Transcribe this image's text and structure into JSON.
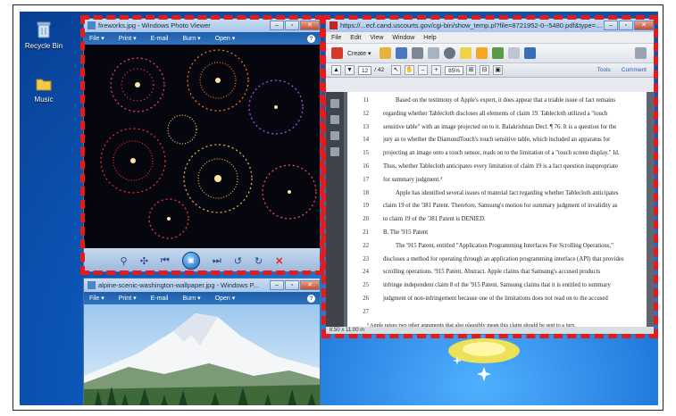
{
  "desktop": {
    "icons": [
      {
        "label": "Recycle Bin",
        "icon": "recycle-bin-icon"
      },
      {
        "label": "Music",
        "icon": "folder-icon"
      }
    ]
  },
  "photo_viewer_1": {
    "title": "fireworks.jpg - Windows Photo Viewer",
    "menu": [
      "File ▾",
      "Print ▾",
      "E-mail",
      "Burn ▾",
      "Open ▾"
    ],
    "controls": [
      "zoom-icon",
      "fit-icon",
      "previous-icon",
      "slideshow-icon",
      "next-icon",
      "rotate-left-icon",
      "rotate-right-icon",
      "delete-icon"
    ]
  },
  "photo_viewer_2": {
    "title": "alpine-scenic-washington-wallpaper.jpg - Windows P...",
    "menu": [
      "File ▾",
      "Print ▾",
      "E-mail",
      "Burn ▾",
      "Open ▾"
    ]
  },
  "pdf_window": {
    "title": "https://...ecf.cand.uscourts.gov/cgi-bin/show_temp.pl?file=8721952-0--5480.pdf&type=applica...",
    "menu": [
      "File",
      "Edit",
      "View",
      "Window",
      "Help"
    ],
    "create_label": "Create ▾",
    "page_current": "12",
    "page_total": "/ 42",
    "zoom": "85%",
    "tools_label": "Tools",
    "comment_label": "Comment",
    "page_size": "8.50 x 11.00 in",
    "lines": [
      {
        "n": "11",
        "t": "Based on the testimony of Apple's expert, it does appear that a triable issue of fact remains"
      },
      {
        "n": "12",
        "t": "regarding whether Tablecloth discloses all elements of claim 19. Tablecloth utilized a \"touch"
      },
      {
        "n": "13",
        "t": "sensitive table\" with an image projected on to it. Balakrishnan Decl. ¶ 76. It is a question for the"
      },
      {
        "n": "14",
        "t": "jury as to whether the DiamondTouch's touch sensitive table, which included an apparatus for"
      },
      {
        "n": "15",
        "t": "projecting an image onto a touch sensor, reads on to the limitation of a \"touch screen display.\" Id."
      },
      {
        "n": "16",
        "t": "Thus, whether Tablecloth anticipates every limitation of claim 19 is a fact question inappropriate"
      },
      {
        "n": "17",
        "t": "for summary judgment.³"
      },
      {
        "n": "18",
        "t": "Apple has identified several issues of material fact regarding whether Tablecloth anticipates"
      },
      {
        "n": "19",
        "t": "claim 19 of the '381 Patent. Therefore, Samsung's motion for summary judgment of invalidity as"
      },
      {
        "n": "20",
        "t": "to claim 19 of the '381 Patent is DENIED."
      },
      {
        "n": "21",
        "t": "B.       The '915 Patent"
      },
      {
        "n": "22",
        "t": "The '915 Patent, entitled \"Application Programming Interfaces For Scrolling Operations,\""
      },
      {
        "n": "23",
        "t": "discloses a method for operating through an application programming interface (API) that provides"
      },
      {
        "n": "24",
        "t": "scrolling operations. '915 Patent, Abstract. Apple claims that Samsung's accused products"
      },
      {
        "n": "25",
        "t": "infringe independent claim 8 of the '915 Patent. Samsung claims that it is entitled to summary"
      },
      {
        "n": "26",
        "t": "judgment of non-infringement because one of the limitations does not read on to the accused"
      },
      {
        "n": "27",
        "t": ""
      },
      {
        "n": "",
        "t": "³ Apple raises two other arguments that also plausibly mean this claim should be sent to a jury."
      }
    ]
  }
}
